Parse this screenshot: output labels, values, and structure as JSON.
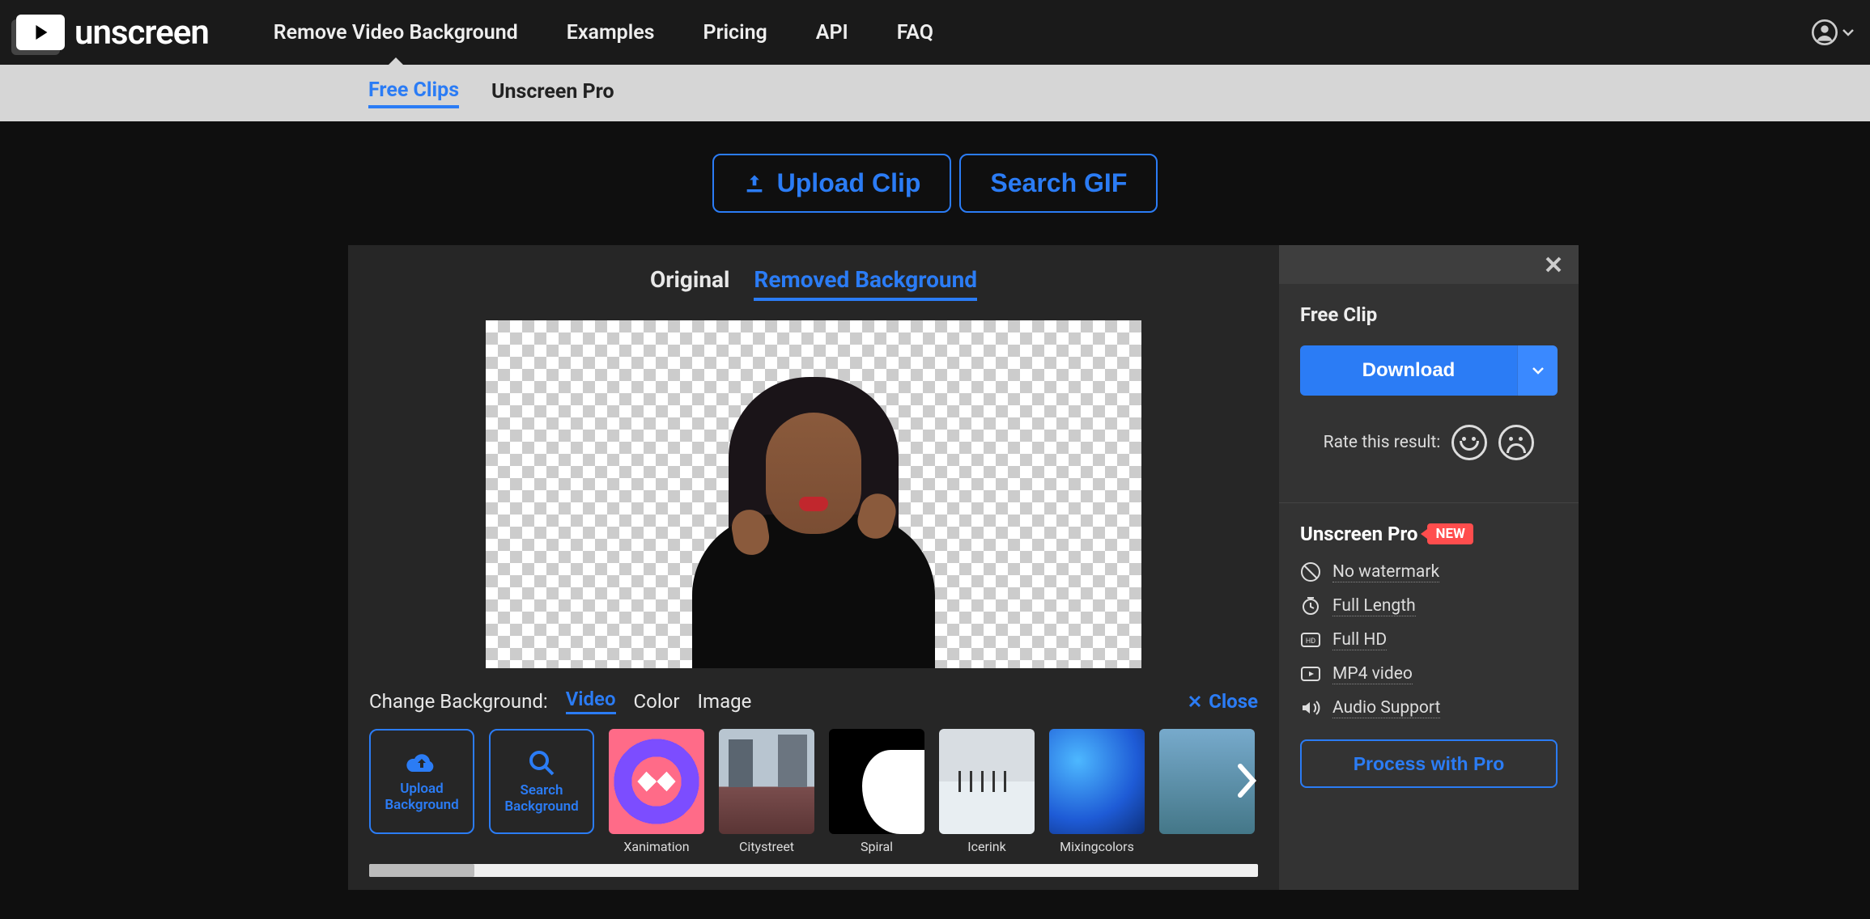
{
  "brand": "unscreen",
  "nav": {
    "items": [
      "Remove Video Background",
      "Examples",
      "Pricing",
      "API",
      "FAQ"
    ],
    "activeIndex": 0
  },
  "subnav": {
    "items": [
      "Free Clips",
      "Unscreen Pro"
    ],
    "activeIndex": 0
  },
  "actions": {
    "upload": "Upload Clip",
    "search": "Search GIF"
  },
  "viewTabs": {
    "original": "Original",
    "removed": "Removed Background",
    "activeIndex": 1
  },
  "changeBg": {
    "label": "Change Background:",
    "tabs": [
      "Video",
      "Color",
      "Image"
    ],
    "activeIndex": 0,
    "close": "Close"
  },
  "thumbActions": {
    "upload": "Upload Background",
    "search": "Search Background"
  },
  "thumbs": [
    {
      "name": "Xanimation",
      "cls": "bg-xanimation"
    },
    {
      "name": "Citystreet",
      "cls": "bg-citystreet"
    },
    {
      "name": "Spiral",
      "cls": "bg-spiral"
    },
    {
      "name": "Icerink",
      "cls": "bg-icerink"
    },
    {
      "name": "Mixingcolors",
      "cls": "bg-mixingcolors"
    }
  ],
  "side": {
    "freeClip": "Free Clip",
    "download": "Download",
    "rateLabel": "Rate this result:",
    "proTitle": "Unscreen Pro",
    "newBadge": "NEW",
    "features": [
      "No watermark",
      "Full Length",
      "Full HD",
      "MP4 video",
      "Audio Support"
    ],
    "processBtn": "Process with Pro"
  }
}
